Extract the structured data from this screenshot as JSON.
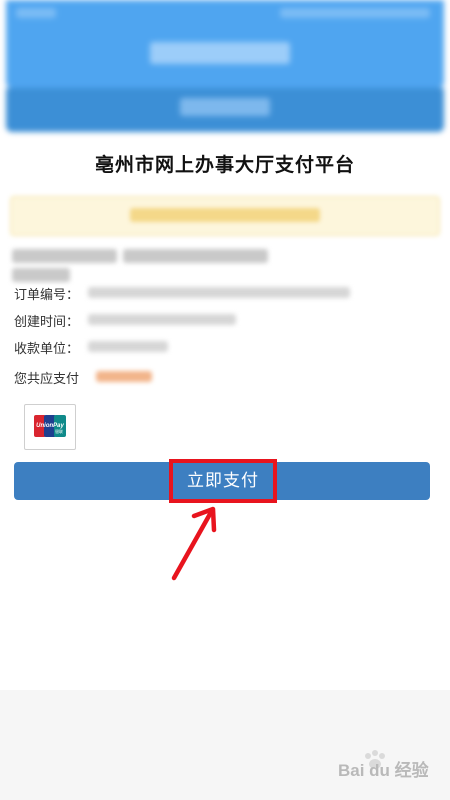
{
  "platform_title": "亳州市网上办事大厅支付平台",
  "order_info": {
    "order_no_label": "订单编号：",
    "created_time_label": "创建时间：",
    "payee_label": "收款单位：",
    "amount_label": "您共应支付"
  },
  "pay_button": {
    "label": "立即支付"
  },
  "payment_method": {
    "name": "UnionPay",
    "sub": "银联"
  },
  "watermark": {
    "text": "Bai du 经验"
  },
  "colors": {
    "header_blue": "#4fa5f0",
    "button_blue": "#3d7fc1",
    "highlight_red": "#e8141e",
    "notice_bg": "#fdf6dc"
  }
}
